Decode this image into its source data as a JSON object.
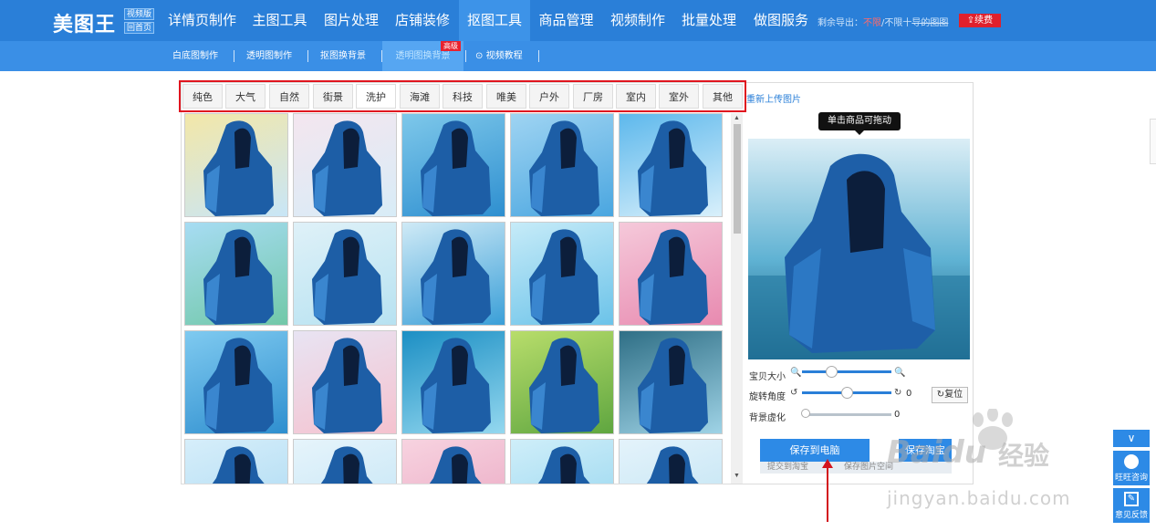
{
  "brand": {
    "logo_text": "美图王",
    "badge_top": "视频版",
    "badge_bottom": "回首页"
  },
  "top_nav": [
    {
      "label": "详情页制作"
    },
    {
      "label": "主图工具"
    },
    {
      "label": "图片处理"
    },
    {
      "label": "店铺装修"
    },
    {
      "label": "抠图工具",
      "active": true
    },
    {
      "label": "商品管理"
    },
    {
      "label": "视频制作"
    },
    {
      "label": "批量处理"
    },
    {
      "label": "做图服务"
    }
  ],
  "quota": {
    "prefix": "剩余导出：",
    "value": "不限",
    "middle": "/不限十",
    "struck": "导的图图",
    "renew": "⇪续费"
  },
  "sub_nav": [
    {
      "label": "白底图制作"
    },
    {
      "label": "透明图制作"
    },
    {
      "label": "抠图换背景"
    },
    {
      "label": "透明图换背景",
      "active": true,
      "badge": "高级"
    },
    {
      "label": "视频教程",
      "icon": "play-circle-icon"
    }
  ],
  "category_tabs": [
    {
      "label": "纯色"
    },
    {
      "label": "大气"
    },
    {
      "label": "自然"
    },
    {
      "label": "街景"
    },
    {
      "label": "洗护",
      "active": true
    },
    {
      "label": "海滩"
    },
    {
      "label": "科技"
    },
    {
      "label": "唯美"
    },
    {
      "label": "户外"
    },
    {
      "label": "厂房"
    },
    {
      "label": "室内"
    },
    {
      "label": "室外"
    },
    {
      "label": "其他"
    }
  ],
  "reupload_link": "重新上传图片",
  "preview_tooltip": "单击商品可拖动",
  "thumbnails": [
    {
      "bg": [
        "#f3e7a8",
        "#c8e6f7"
      ]
    },
    {
      "bg": [
        "#f4e6ef",
        "#d8ecf7"
      ]
    },
    {
      "bg": [
        "#7ec8ea",
        "#2e8fd0"
      ]
    },
    {
      "bg": [
        "#9fd4f2",
        "#4aa6e0"
      ]
    },
    {
      "bg": [
        "#5db8ec",
        "#d9f0fb"
      ]
    },
    {
      "bg": [
        "#a7dcf3",
        "#71c8a8"
      ]
    },
    {
      "bg": [
        "#dff1f8",
        "#b7e2f1"
      ]
    },
    {
      "bg": [
        "#cfeaf6",
        "#3a9fd8"
      ]
    },
    {
      "bg": [
        "#c6ebf8",
        "#6cc3e9"
      ]
    },
    {
      "bg": [
        "#f5c9da",
        "#e88ab0"
      ]
    },
    {
      "bg": [
        "#7fcaf0",
        "#2f8fcf"
      ]
    },
    {
      "bg": [
        "#e8e4f3",
        "#f5c2cf"
      ]
    },
    {
      "bg": [
        "#1c8fc4",
        "#94d8ef"
      ]
    },
    {
      "bg": [
        "#b8dd6b",
        "#5fa640"
      ]
    },
    {
      "bg": [
        "#2f6f86",
        "#9fd3e6"
      ]
    },
    {
      "bg": [
        "#d6eefa",
        "#a8d8f2"
      ]
    },
    {
      "bg": [
        "#e6f4fb",
        "#bfe3f5"
      ]
    },
    {
      "bg": [
        "#f7d3e0",
        "#e9a3bf"
      ]
    },
    {
      "bg": [
        "#cfeef9",
        "#8fd3ee"
      ]
    },
    {
      "bg": [
        "#e4f3fb",
        "#bbe1f2"
      ]
    }
  ],
  "controls": {
    "size_label": "宝贝大小",
    "size_level": 0.3,
    "rotate_label": "旋转角度",
    "rotate_value": "0",
    "rotate_level": 0.5,
    "blur_label": "背景虚化",
    "blur_value": "0",
    "blur_level": 0.0,
    "reset_label": "复位"
  },
  "actions": {
    "save_pc": "保存到电脑",
    "save_other": "保存淘宝",
    "submit_taobao": "提交到淘宝",
    "save_space": "保存图片空间"
  },
  "watermark": {
    "logo": "Bai",
    "logo_du": "du",
    "jingyan": "经验",
    "url": "jingyan.baidu.com"
  },
  "side_buttons": {
    "wangwang": "旺旺咨询",
    "feedback": "意见反馈"
  },
  "colors": {
    "nav_blue": "#2a7fd8",
    "subnav_blue": "#3a8fe6",
    "highlight_red": "#e0151f",
    "button_blue": "#2d8ae6"
  }
}
